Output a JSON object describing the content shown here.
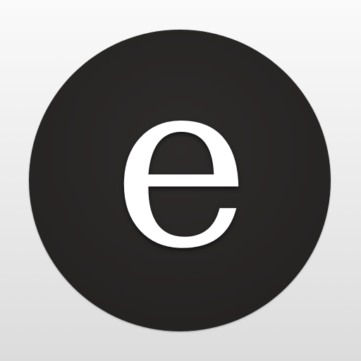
{
  "icon": {
    "glyph": "e",
    "name": "e-letter-icon",
    "colors": {
      "background_top": "#fafafa",
      "background_bottom": "#dcdcdc",
      "circle": "#272424",
      "glyph": "#ffffff"
    }
  }
}
